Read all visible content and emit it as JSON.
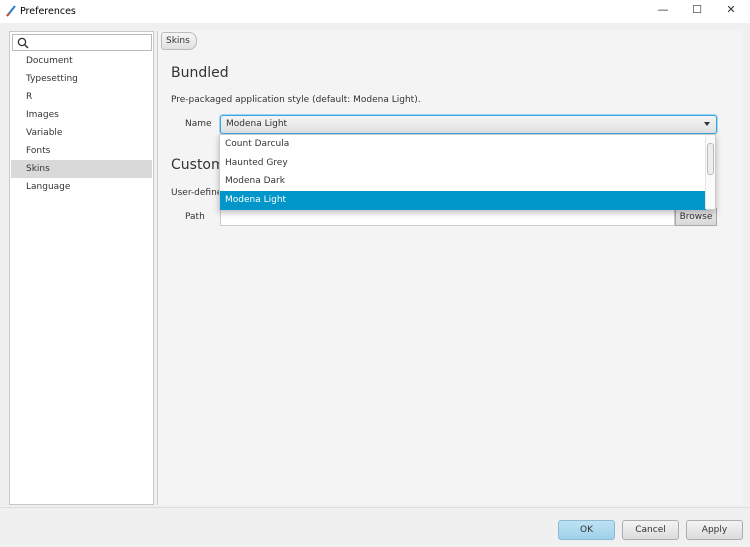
{
  "window": {
    "title": "Preferences",
    "controls": [
      "minimize",
      "maximize",
      "close"
    ]
  },
  "sidebar": {
    "search_placeholder": "",
    "items": [
      {
        "label": "Document"
      },
      {
        "label": "Typesetting"
      },
      {
        "label": "R"
      },
      {
        "label": "Images"
      },
      {
        "label": "Variable"
      },
      {
        "label": "Fonts"
      },
      {
        "label": "Skins",
        "selected": true
      },
      {
        "label": "Language"
      }
    ]
  },
  "main": {
    "breadcrumb": "Skins",
    "bundled": {
      "heading": "Bundled",
      "description": "Pre-packaged application style (default: Modena Light).",
      "name_label": "Name",
      "selected": "Modena Light",
      "options": [
        "Count Darcula",
        "Haunted Grey",
        "Modena Dark",
        "Modena Light"
      ]
    },
    "custom": {
      "heading": "Custom",
      "description": "User-defined",
      "path_label": "Path",
      "path_value": "",
      "browse_label": "Browse"
    }
  },
  "footer": {
    "ok": "OK",
    "cancel": "Cancel",
    "apply": "Apply"
  },
  "colors": {
    "accent": "#0096c9",
    "ok_button": "#a8d7ee"
  }
}
